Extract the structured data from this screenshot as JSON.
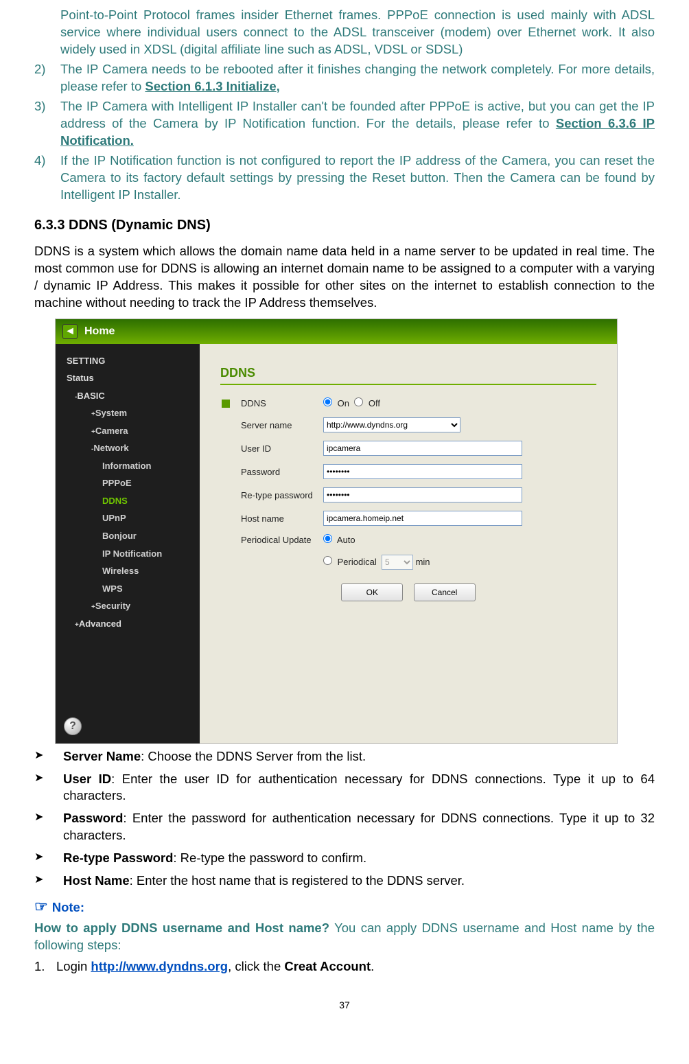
{
  "top_para": "Point-to-Point Protocol frames insider Ethernet frames. PPPoE connection is used mainly with ADSL service where individual users connect to the ADSL transceiver (modem) over Ethernet work. It also widely used in XDSL (digital affiliate line such as ADSL, VDSL or SDSL)",
  "list": {
    "n2": "2)",
    "t2a": "The IP Camera needs to be rebooted after it finishes changing the network completely. For more details, please refer to ",
    "t2link": "Section 6.1.3 Initialize,",
    "n3": "3)",
    "t3a": "The IP Camera with Intelligent IP Installer can't be founded after PPPoE is active, but you can get the IP address of the Camera by IP Notification function. For the details, please refer to",
    "t3link": " Section 6.3.6 IP Notification.",
    "n4": "4)",
    "t4": "If the IP Notification function is not configured to report the IP address of the Camera, you can reset the Camera to its factory default settings by pressing the Reset button. Then the Camera can be found by Intelligent IP Installer."
  },
  "heading": "6.3.3   DDNS (Dynamic DNS)",
  "ddns_para": "DDNS is a system which allows the domain name data held in a name server to be updated in real time. The most common use for DDNS is allowing an internet domain name to be assigned to a computer with a varying / dynamic IP Address. This makes it possible for other sites on the internet to establish connection to the machine without needing to track the IP Address themselves.",
  "ui": {
    "home": "Home",
    "setting": "SETTING",
    "status": "Status",
    "basic": "BASIC",
    "system": "System",
    "camera": "Camera",
    "network": "Network",
    "information": "Information",
    "pppoe": "PPPoE",
    "ddns": "DDNS",
    "upnp": "UPnP",
    "bonjour": "Bonjour",
    "ipnotif": "IP Notification",
    "wireless": "Wireless",
    "wps": "WPS",
    "security": "Security",
    "advanced": "Advanced",
    "panel_title": "DDNS",
    "lbl_ddns": "DDNS",
    "on": "On",
    "off": "Off",
    "lbl_server": "Server name",
    "val_server": "http://www.dyndns.org",
    "lbl_userid": "User ID",
    "val_userid": "ipcamera",
    "lbl_pw": "Password",
    "val_pw": "••••••••",
    "lbl_repw": "Re-type password",
    "val_repw": "••••••••",
    "lbl_host": "Host name",
    "val_host": "ipcamera.homeip.net",
    "lbl_periodical": "Periodical Update",
    "auto": "Auto",
    "periodical": "Periodical",
    "min": "min",
    "five": "5",
    "ok": "OK",
    "cancel": "Cancel",
    "help": "?"
  },
  "bullets": {
    "b1t": "Server Name",
    "b1": ": Choose the DDNS Server from the list.",
    "b2t": "User ID",
    "b2": ": Enter the user ID for authentication necessary for DDNS connections. Type it up to 64 characters.",
    "b3t": "Password",
    "b3": ": Enter the password for authentication necessary for DDNS connections. Type it up to 32 characters.",
    "b4t": "Re-type Password",
    "b4": ": Re-type the password to confirm.",
    "b5t": "Host Name",
    "b5": ": Enter the host name that is registered to the DDNS server."
  },
  "note": "Note:",
  "howto_q": "How to apply DDNS username and Host name?",
  "howto_a": " You can apply DDNS username and Host name by the following steps:",
  "step1_n": "1.",
  "step1_a": "Login ",
  "step1_link": "http://www.dyndns.org",
  "step1_b": ", click the ",
  "step1_c": "Creat Account",
  "step1_d": ".",
  "page": "37"
}
